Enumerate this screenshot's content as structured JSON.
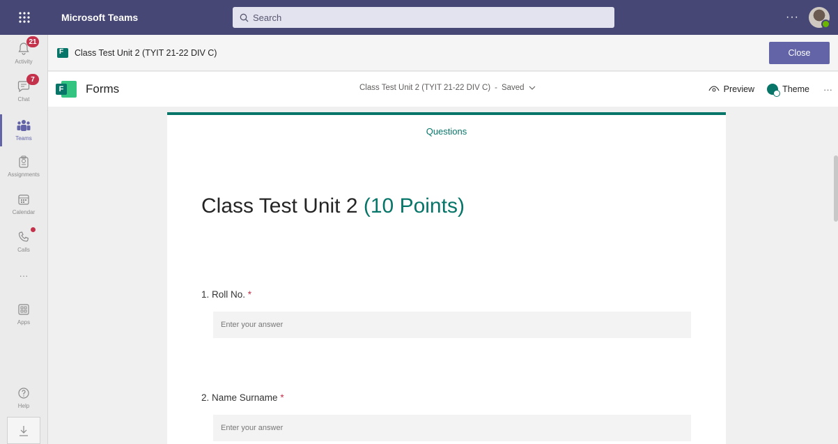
{
  "topbar": {
    "app_title": "Microsoft Teams",
    "search_placeholder": "Search",
    "more": "···"
  },
  "rail": {
    "items": [
      {
        "label": "Activity",
        "badge": "21",
        "icon": "bell-icon"
      },
      {
        "label": "Chat",
        "badge": "7",
        "icon": "chat-icon"
      },
      {
        "label": "Teams",
        "icon": "teams-icon"
      },
      {
        "label": "Assignments",
        "icon": "assignments-icon"
      },
      {
        "label": "Calendar",
        "icon": "calendar-icon"
      },
      {
        "label": "Calls",
        "icon": "phone-icon"
      },
      {
        "label": "···",
        "icon": "more-apps-icon"
      },
      {
        "label": "Apps",
        "icon": "apps-icon"
      },
      {
        "label": "Help",
        "icon": "help-icon"
      }
    ],
    "download_icon": "download-icon"
  },
  "header": {
    "title": "Class Test Unit 2 (TYIT 21-22 DIV C)",
    "close_label": "Close"
  },
  "toolbar": {
    "app_name": "Forms",
    "doc_title": "Class Test Unit 2 (TYIT 21-22 DIV C)",
    "separator": "-",
    "status": "Saved",
    "preview_label": "Preview",
    "theme_label": "Theme",
    "more": "···"
  },
  "form": {
    "tab": "Questions",
    "title": "Class Test Unit 2",
    "points": "(10 Points)",
    "questions": [
      {
        "label": "1. Roll No.",
        "required": "*",
        "placeholder": "Enter your answer"
      },
      {
        "label": "2. Name Surname",
        "required": "*",
        "placeholder": "Enter your answer"
      }
    ]
  },
  "colors": {
    "teams_bar": "#464775",
    "accent": "#6264a7",
    "forms_green": "#077568",
    "badge_red": "#c4314b"
  }
}
